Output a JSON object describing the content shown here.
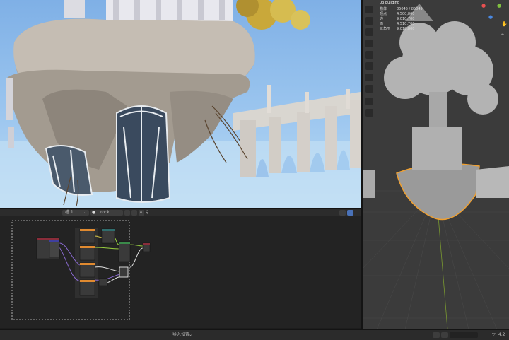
{
  "node_editor": {
    "header": {
      "slot_label": "槽 1",
      "material_name": "rock"
    }
  },
  "viewport_3d": {
    "object_name": "03 building",
    "stats": [
      {
        "label": "物体",
        "value": "85045 / 85045"
      },
      {
        "label": "顶点",
        "value": "4,500,800"
      },
      {
        "label": "边",
        "value": "9,010,700"
      },
      {
        "label": "面",
        "value": "4,510,700"
      },
      {
        "label": "三角形",
        "value": "9,010,800"
      }
    ]
  },
  "status_bar": {
    "center_label": "导入设置",
    "version": "4.2"
  },
  "colors": {
    "selection_outline": "#f0a030",
    "node_orange": "#e08a30",
    "link_purple": "#8a6ad0",
    "link_green": "#9ad040",
    "link_yellow": "#d8c84a"
  }
}
